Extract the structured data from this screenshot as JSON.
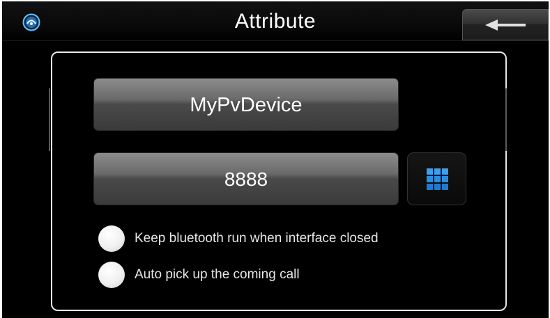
{
  "window": {
    "title": "Attribute",
    "app_icon": "bluetooth-app-icon",
    "back_icon": "left-arrow-icon"
  },
  "device": {
    "name": "MyPvDevice",
    "pin": "8888",
    "keypad_icon": "keypad-grid-icon"
  },
  "options": [
    {
      "label": "Keep bluetooth run when interface closed",
      "checked": false
    },
    {
      "label": "Auto pick up the coming call",
      "checked": false
    }
  ],
  "colors": {
    "background": "#000000",
    "text": "#ffffff",
    "accent": "#3aa0f0",
    "panel_border": "#e8e8e8"
  }
}
